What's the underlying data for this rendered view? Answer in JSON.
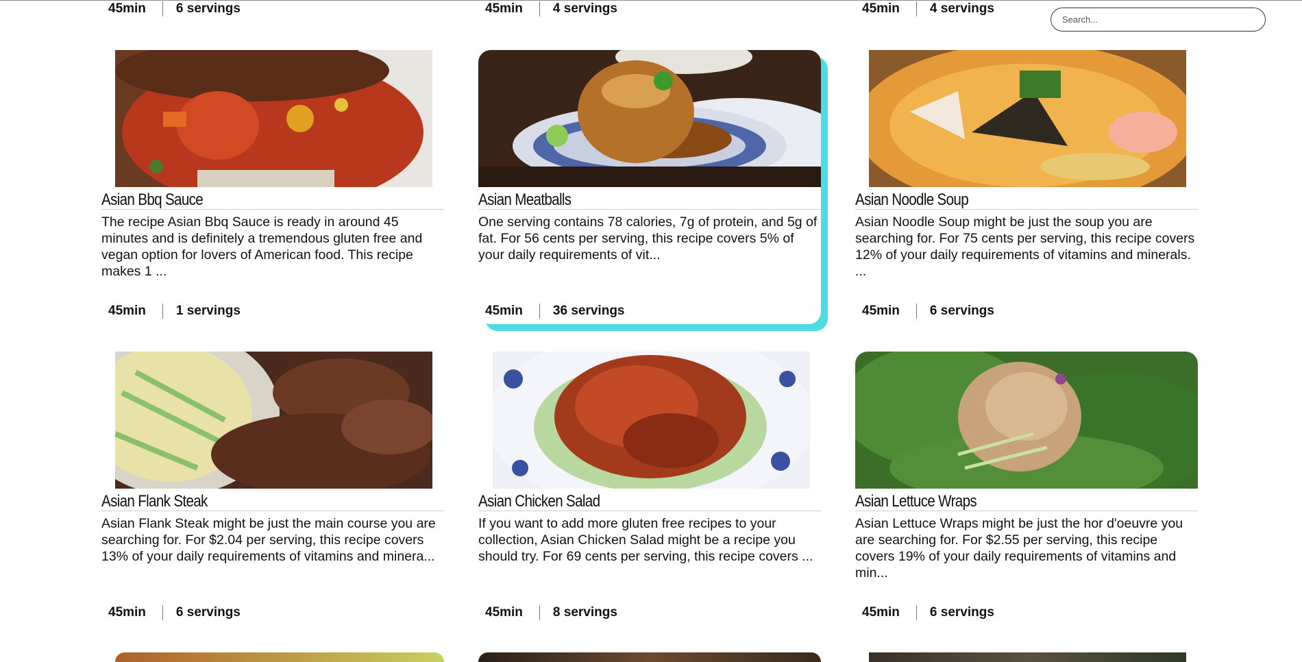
{
  "search": {
    "placeholder": "Search..."
  },
  "top_row_meta": [
    {
      "time": "45min",
      "servings": "6 servings"
    },
    {
      "time": "45min",
      "servings": "4 servings"
    },
    {
      "time": "45min",
      "servings": "4 servings"
    }
  ],
  "recipes": [
    {
      "title": "Asian Bbq Sauce",
      "description": "The recipe Asian Bbq Sauce is ready in around 45 minutes and is definitely a tremendous gluten free and vegan option for lovers of American food. This recipe makes 1 ...",
      "time": "45min",
      "servings": "1 servings",
      "image_icon": "bbq-sauce-photo"
    },
    {
      "title": "Asian Meatballs",
      "description": "One serving contains 78 calories, 7g of protein, and 5g of fat. For 56 cents per serving, this recipe covers 5% of your daily requirements of vit...",
      "time": "45min",
      "servings": "36 servings",
      "image_icon": "meatball-photo"
    },
    {
      "title": "Asian Noodle Soup",
      "description": "Asian Noodle Soup might be just the soup you are searching for. For 75 cents per serving, this recipe covers 12% of your daily requirements of vitamins and minerals. ...",
      "time": "45min",
      "servings": "6 servings",
      "image_icon": "noodle-soup-photo"
    },
    {
      "title": "Asian Flank Steak",
      "description": "Asian Flank Steak might be just the main course you are searching for. For $2.04 per serving, this recipe covers 13% of your daily requirements of vitamins and minera...",
      "time": "45min",
      "servings": "6 servings",
      "image_icon": "flank-steak-photo"
    },
    {
      "title": "Asian Chicken Salad",
      "description": "If you want to add more gluten free recipes to your collection, Asian Chicken Salad might be a recipe you should try. For 69 cents per serving, this recipe covers ...",
      "time": "45min",
      "servings": "8 servings",
      "image_icon": "chicken-salad-photo"
    },
    {
      "title": "Asian Lettuce Wraps",
      "description": "Asian Lettuce Wraps might be just the hor d'oeuvre you are searching for. For $2.55 per serving, this recipe covers 19% of your daily requirements of vitamins and min...",
      "time": "45min",
      "servings": "6 servings",
      "image_icon": "lettuce-wraps-photo"
    }
  ],
  "colors": {
    "highlight": "#4fdbe4",
    "text": "#111111"
  }
}
